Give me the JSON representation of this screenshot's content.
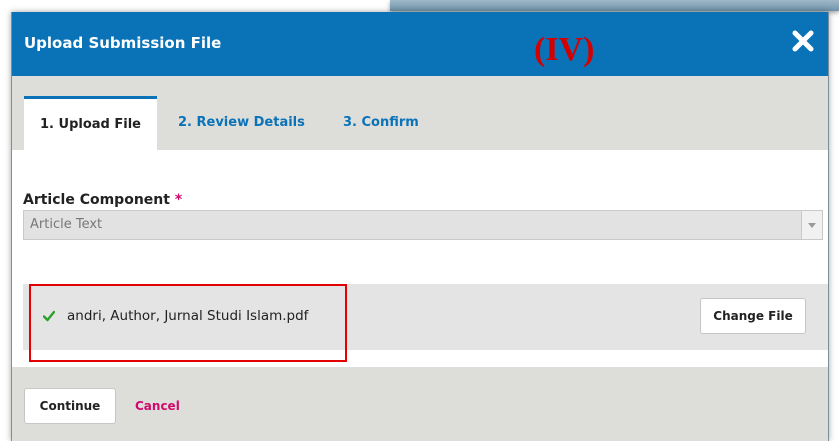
{
  "dialog": {
    "title": "Upload Submission File",
    "annotation": "(IV)",
    "close_icon": "close-x-icon"
  },
  "tabs": [
    {
      "label": "1. Upload File",
      "active": true
    },
    {
      "label": "2. Review Details",
      "active": false
    },
    {
      "label": "3. Confirm",
      "active": false
    }
  ],
  "article_component": {
    "label": "Article Component",
    "required_marker": "*",
    "selected_value": "Article Text"
  },
  "file": {
    "name": "andri, Author, Jurnal Studi Islam.pdf",
    "status_icon": "checkmark-icon",
    "change_label": "Change File"
  },
  "footer": {
    "continue_label": "Continue",
    "cancel_label": "Cancel"
  },
  "colors": {
    "header": "#0a73b8",
    "accent_link": "#0a73b8",
    "cancel": "#d00a6c",
    "success": "#2ea02e",
    "annotation": "#d40000"
  }
}
